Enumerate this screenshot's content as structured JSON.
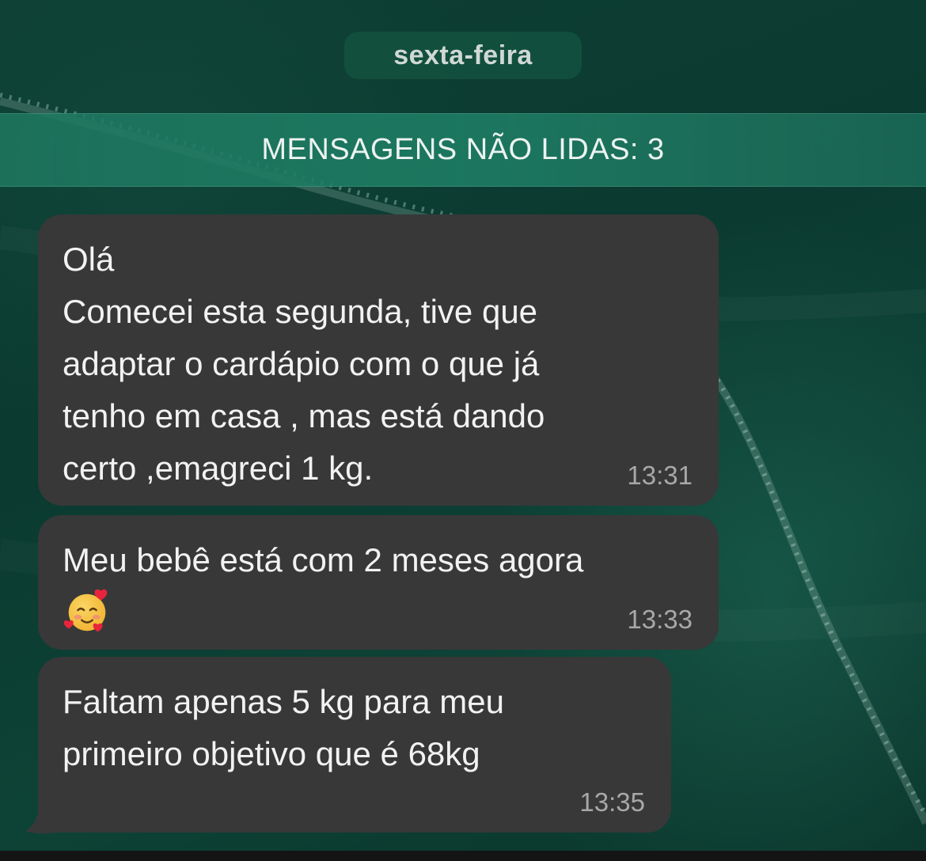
{
  "date_separator": "sexta-feira",
  "unread_banner": "MENSAGENS NÃO LIDAS: 3",
  "messages": [
    {
      "text": "Olá\nComecei esta segunda, tive que\nadaptar o cardápio com o que já\ntenho em casa , mas está dando\ncerto ,emagreci 1 kg.",
      "time": "13:31"
    },
    {
      "text": "Meu bebê está com 2 meses agora",
      "emoji": "smiling-face-with-hearts-icon",
      "time": "13:33"
    },
    {
      "text": "Faltam apenas 5 kg para meu\nprimeiro objetivo que é 68kg",
      "time": "13:35"
    }
  ],
  "colors": {
    "bubble": "#383838",
    "background": "#0d3a30",
    "unread_bar": "#1e7d64",
    "date_pill": "#14503e"
  }
}
